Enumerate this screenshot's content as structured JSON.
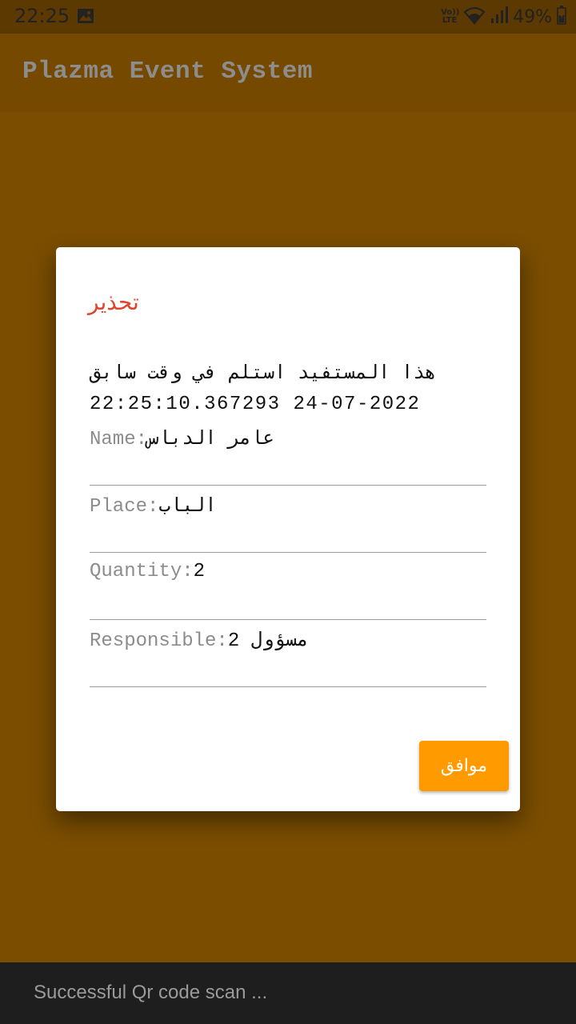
{
  "status_bar": {
    "time": "22:25",
    "volte_top": "Vo))",
    "volte_bottom": "LTE",
    "battery_percent": "49%",
    "icons": [
      "image-icon",
      "volte-icon",
      "wifi-icon",
      "signal-icon",
      "battery-icon"
    ]
  },
  "app_bar": {
    "title": "Plazma Event System"
  },
  "dialog": {
    "title": "تحذير",
    "message_line1": "هذا المستفيد استلم في وقت سابق",
    "message_line2": "22:25:10.367293 24-07-2022",
    "fields": [
      {
        "label": "Name:",
        "value": "عامر الدباس"
      },
      {
        "label": "Place:",
        "value": "الباب"
      },
      {
        "label": "Quantity:",
        "value": "2"
      },
      {
        "label": "Responsible:",
        "value": "مسؤول 2"
      }
    ],
    "ok_button": "موافق"
  },
  "snackbar": {
    "text": "Successful Qr code scan ..."
  },
  "colors": {
    "background": "#7a4d00",
    "app_bar": "#754a00",
    "status_bar": "#5c3900",
    "dialog_title": "#e0442b",
    "button": "#ff9a00",
    "snackbar": "#1e1e1e"
  }
}
